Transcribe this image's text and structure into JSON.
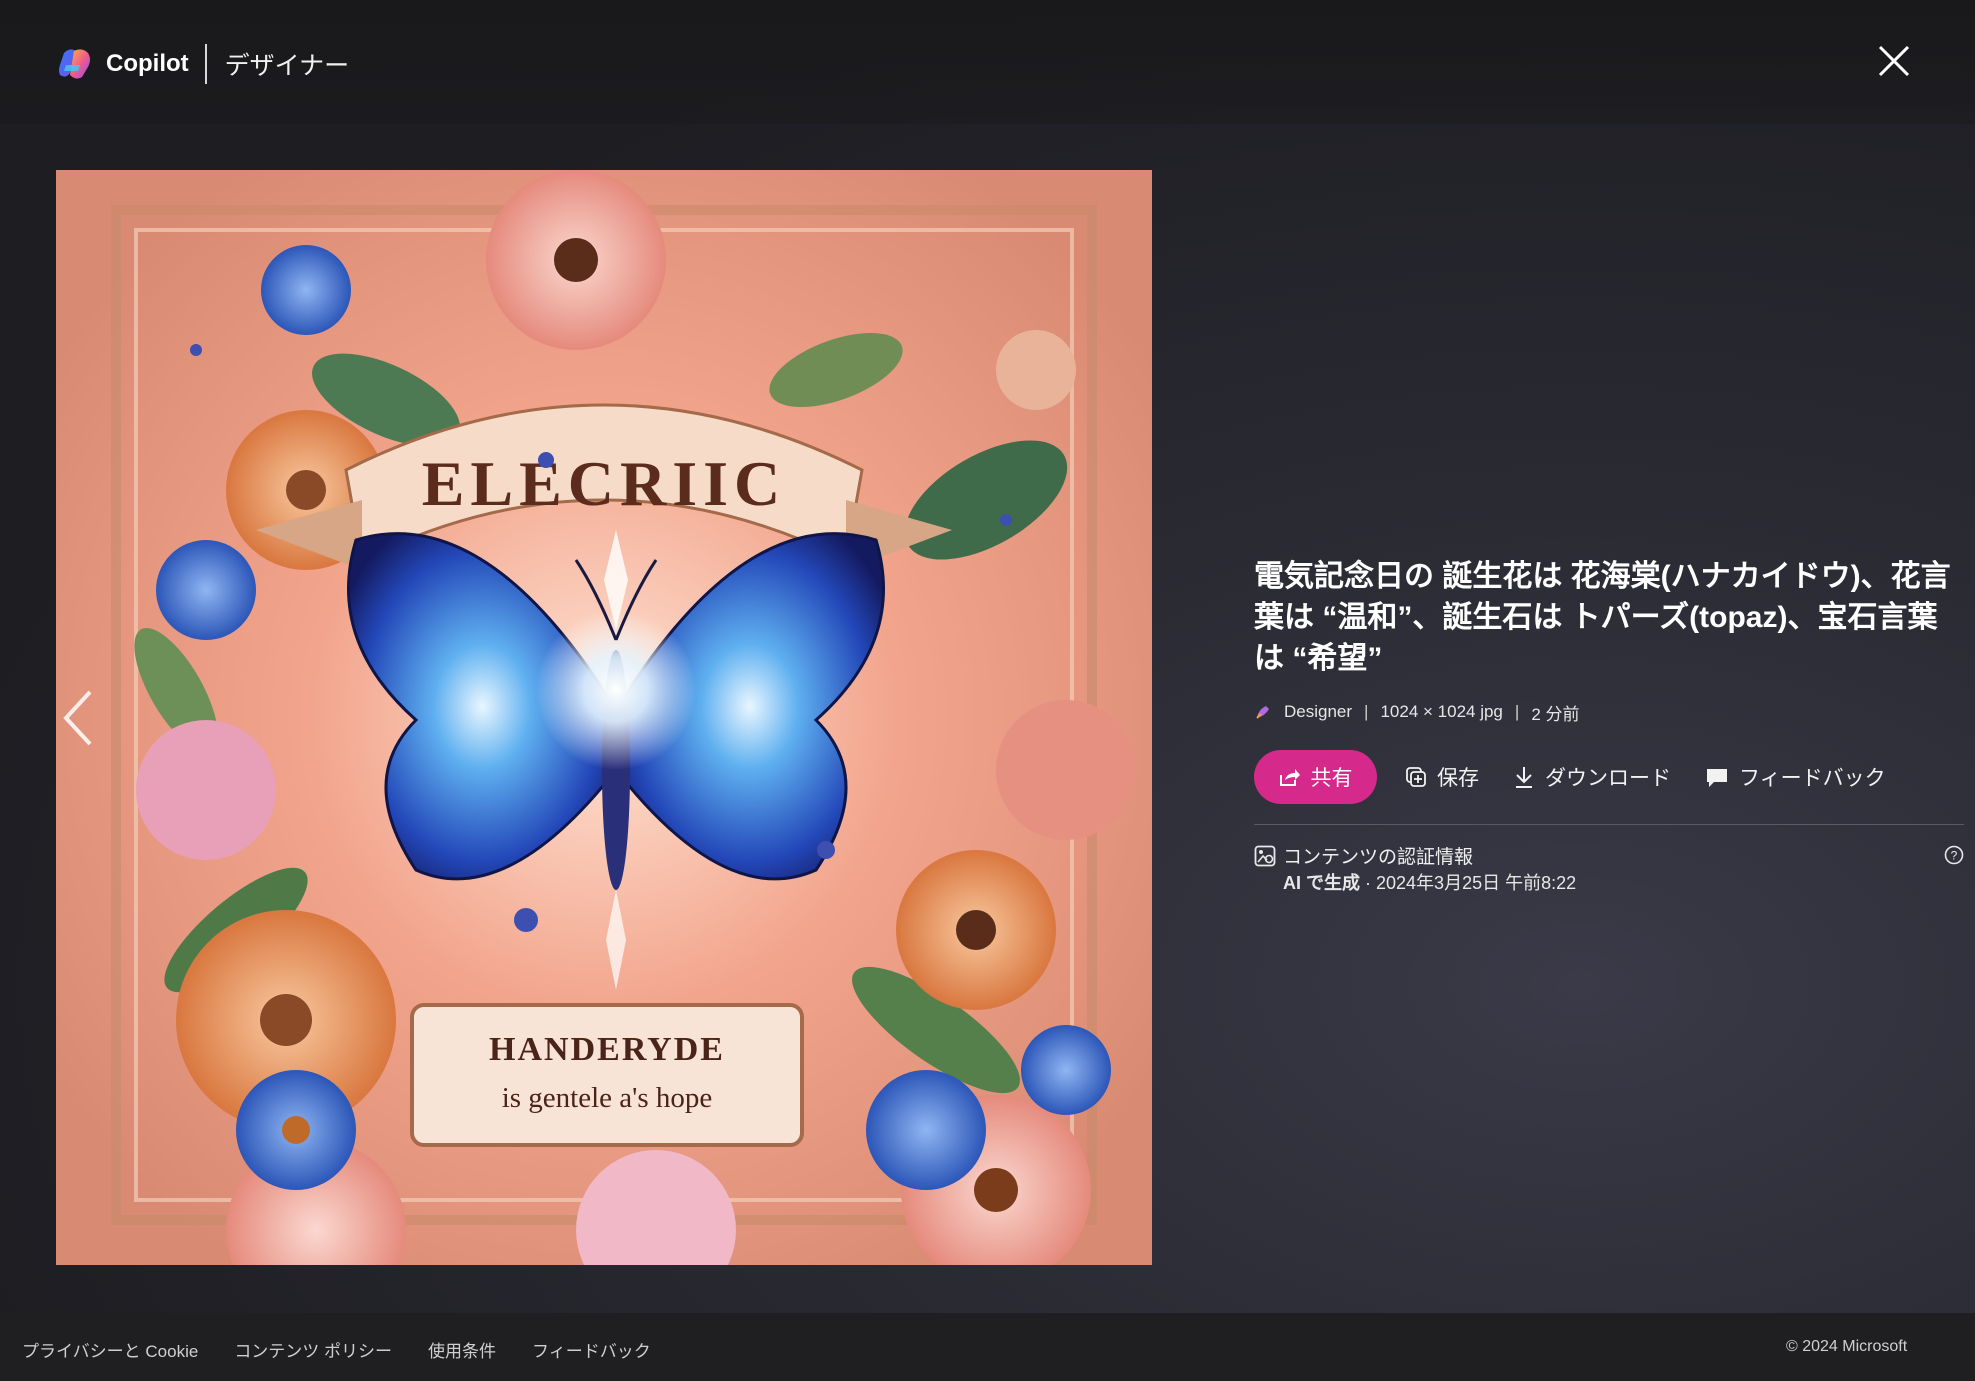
{
  "header": {
    "brand_name": "Copilot",
    "product_name": "デザイナー",
    "close_icon": "close-icon"
  },
  "image": {
    "banner_text": "ELECRIIC",
    "plaque_line1": "HANDERYDE",
    "plaque_line2": "is gentele a's hope",
    "prev_icon": "chevron-left-icon"
  },
  "info": {
    "title": "電気記念日の 誕生花は 花海棠(ハナカイドウ)、花言葉は “温和”、誕生石は トパーズ(topaz)、宝石言葉は “希望”",
    "meta": {
      "source": "Designer",
      "dimensions": "1024 × 1024 jpg",
      "age": "2 分前",
      "separator": "|"
    },
    "actions": {
      "share": "共有",
      "save": "保存",
      "download": "ダウンロード",
      "feedback": "フィードバック"
    },
    "credentials": {
      "title": "コンテンツの認証情報",
      "generated_label": "AI で生成",
      "generated_detail": " · 2024年3月25日 午前8:22"
    }
  },
  "footer": {
    "links": [
      "プライバシーと Cookie",
      "コンテンツ ポリシー",
      "使用条件",
      "フィードバック"
    ],
    "copyright": "© 2024 Microsoft"
  },
  "colors": {
    "accent": "#d6298c",
    "background": "#1e1e22"
  }
}
